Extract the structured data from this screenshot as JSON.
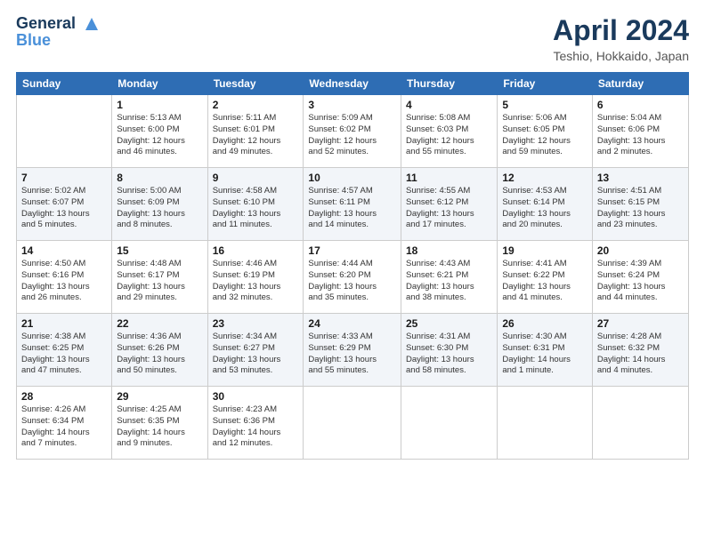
{
  "header": {
    "logo_line1": "General",
    "logo_line2": "Blue",
    "month_title": "April 2024",
    "location": "Teshio, Hokkaido, Japan"
  },
  "weekdays": [
    "Sunday",
    "Monday",
    "Tuesday",
    "Wednesday",
    "Thursday",
    "Friday",
    "Saturday"
  ],
  "weeks": [
    [
      {
        "day": "",
        "info": ""
      },
      {
        "day": "1",
        "info": "Sunrise: 5:13 AM\nSunset: 6:00 PM\nDaylight: 12 hours\nand 46 minutes."
      },
      {
        "day": "2",
        "info": "Sunrise: 5:11 AM\nSunset: 6:01 PM\nDaylight: 12 hours\nand 49 minutes."
      },
      {
        "day": "3",
        "info": "Sunrise: 5:09 AM\nSunset: 6:02 PM\nDaylight: 12 hours\nand 52 minutes."
      },
      {
        "day": "4",
        "info": "Sunrise: 5:08 AM\nSunset: 6:03 PM\nDaylight: 12 hours\nand 55 minutes."
      },
      {
        "day": "5",
        "info": "Sunrise: 5:06 AM\nSunset: 6:05 PM\nDaylight: 12 hours\nand 59 minutes."
      },
      {
        "day": "6",
        "info": "Sunrise: 5:04 AM\nSunset: 6:06 PM\nDaylight: 13 hours\nand 2 minutes."
      }
    ],
    [
      {
        "day": "7",
        "info": "Sunrise: 5:02 AM\nSunset: 6:07 PM\nDaylight: 13 hours\nand 5 minutes."
      },
      {
        "day": "8",
        "info": "Sunrise: 5:00 AM\nSunset: 6:09 PM\nDaylight: 13 hours\nand 8 minutes."
      },
      {
        "day": "9",
        "info": "Sunrise: 4:58 AM\nSunset: 6:10 PM\nDaylight: 13 hours\nand 11 minutes."
      },
      {
        "day": "10",
        "info": "Sunrise: 4:57 AM\nSunset: 6:11 PM\nDaylight: 13 hours\nand 14 minutes."
      },
      {
        "day": "11",
        "info": "Sunrise: 4:55 AM\nSunset: 6:12 PM\nDaylight: 13 hours\nand 17 minutes."
      },
      {
        "day": "12",
        "info": "Sunrise: 4:53 AM\nSunset: 6:14 PM\nDaylight: 13 hours\nand 20 minutes."
      },
      {
        "day": "13",
        "info": "Sunrise: 4:51 AM\nSunset: 6:15 PM\nDaylight: 13 hours\nand 23 minutes."
      }
    ],
    [
      {
        "day": "14",
        "info": "Sunrise: 4:50 AM\nSunset: 6:16 PM\nDaylight: 13 hours\nand 26 minutes."
      },
      {
        "day": "15",
        "info": "Sunrise: 4:48 AM\nSunset: 6:17 PM\nDaylight: 13 hours\nand 29 minutes."
      },
      {
        "day": "16",
        "info": "Sunrise: 4:46 AM\nSunset: 6:19 PM\nDaylight: 13 hours\nand 32 minutes."
      },
      {
        "day": "17",
        "info": "Sunrise: 4:44 AM\nSunset: 6:20 PM\nDaylight: 13 hours\nand 35 minutes."
      },
      {
        "day": "18",
        "info": "Sunrise: 4:43 AM\nSunset: 6:21 PM\nDaylight: 13 hours\nand 38 minutes."
      },
      {
        "day": "19",
        "info": "Sunrise: 4:41 AM\nSunset: 6:22 PM\nDaylight: 13 hours\nand 41 minutes."
      },
      {
        "day": "20",
        "info": "Sunrise: 4:39 AM\nSunset: 6:24 PM\nDaylight: 13 hours\nand 44 minutes."
      }
    ],
    [
      {
        "day": "21",
        "info": "Sunrise: 4:38 AM\nSunset: 6:25 PM\nDaylight: 13 hours\nand 47 minutes."
      },
      {
        "day": "22",
        "info": "Sunrise: 4:36 AM\nSunset: 6:26 PM\nDaylight: 13 hours\nand 50 minutes."
      },
      {
        "day": "23",
        "info": "Sunrise: 4:34 AM\nSunset: 6:27 PM\nDaylight: 13 hours\nand 53 minutes."
      },
      {
        "day": "24",
        "info": "Sunrise: 4:33 AM\nSunset: 6:29 PM\nDaylight: 13 hours\nand 55 minutes."
      },
      {
        "day": "25",
        "info": "Sunrise: 4:31 AM\nSunset: 6:30 PM\nDaylight: 13 hours\nand 58 minutes."
      },
      {
        "day": "26",
        "info": "Sunrise: 4:30 AM\nSunset: 6:31 PM\nDaylight: 14 hours\nand 1 minute."
      },
      {
        "day": "27",
        "info": "Sunrise: 4:28 AM\nSunset: 6:32 PM\nDaylight: 14 hours\nand 4 minutes."
      }
    ],
    [
      {
        "day": "28",
        "info": "Sunrise: 4:26 AM\nSunset: 6:34 PM\nDaylight: 14 hours\nand 7 minutes."
      },
      {
        "day": "29",
        "info": "Sunrise: 4:25 AM\nSunset: 6:35 PM\nDaylight: 14 hours\nand 9 minutes."
      },
      {
        "day": "30",
        "info": "Sunrise: 4:23 AM\nSunset: 6:36 PM\nDaylight: 14 hours\nand 12 minutes."
      },
      {
        "day": "",
        "info": ""
      },
      {
        "day": "",
        "info": ""
      },
      {
        "day": "",
        "info": ""
      },
      {
        "day": "",
        "info": ""
      }
    ]
  ]
}
